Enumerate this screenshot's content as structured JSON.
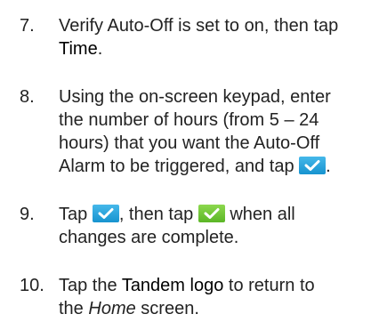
{
  "steps": [
    {
      "number": "7.",
      "parts": [
        "Verify Auto-Off is set to on, then tap",
        "Time",
        "."
      ]
    },
    {
      "number": "8.",
      "parts": [
        "Using the on-screen keypad, enter",
        "the number of hours (from 5 – 24",
        "hours) that you want the Auto-Off",
        "Alarm to be triggered, and tap",
        "."
      ]
    },
    {
      "number": "9.",
      "parts": [
        "Tap",
        ", then tap",
        "when all",
        "changes are complete."
      ]
    },
    {
      "number": "10.",
      "parts": [
        "Tap the",
        "Tandem logo",
        "to return to",
        "the",
        "Home",
        "screen."
      ]
    }
  ],
  "icons": {
    "confirm_blue": "checkmark-icon",
    "confirm_green": "checkmark-icon"
  },
  "colors": {
    "text": "#222222",
    "blue_button": "#2aa6e0",
    "green_button": "#6cc434"
  }
}
